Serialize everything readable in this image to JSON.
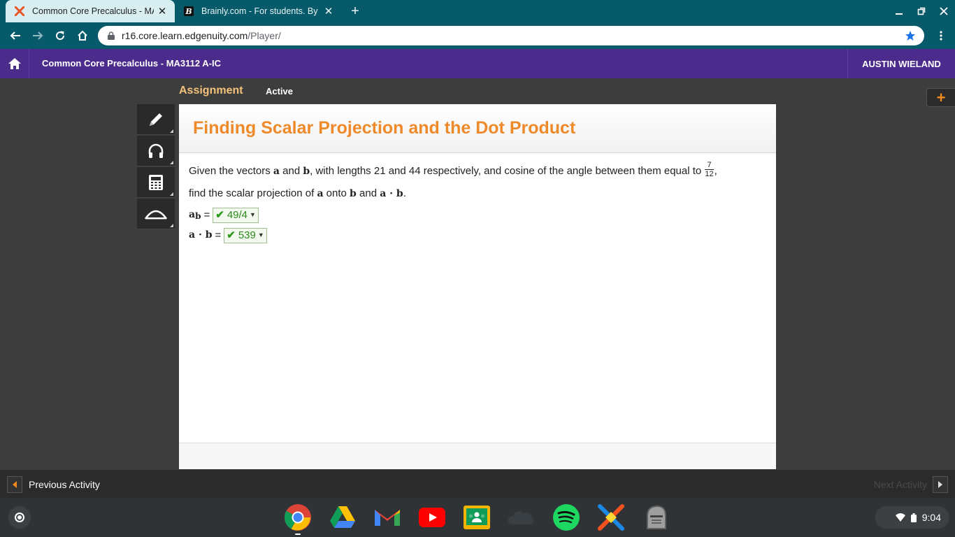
{
  "browser": {
    "tabs": [
      {
        "title": "Common Core Precalculus - MA",
        "favicon": "edgenuity-x-icon",
        "active": true
      },
      {
        "title": "Brainly.com - For students. By st",
        "favicon": "brainly-b-icon",
        "active": false
      }
    ],
    "url_host": "r16.core.learn.edgenuity.com",
    "url_path": "/Player/"
  },
  "header": {
    "course_title": "Common Core Precalculus - MA3112 A-IC",
    "user_name": "AUSTIN WIELAND"
  },
  "assignment": {
    "label": "Assignment",
    "status": "Active"
  },
  "tools": [
    {
      "name": "pencil-icon"
    },
    {
      "name": "headphones-icon"
    },
    {
      "name": "calculator-icon"
    },
    {
      "name": "formula-icon"
    }
  ],
  "question": {
    "title": "Finding Scalar Projection and the Dot Product",
    "text_1": "Given the vectors ",
    "vec_a": "a",
    "text_2": " and ",
    "vec_b": "b",
    "text_3": ", with lengths 21 and 44 respectively, and cosine of the angle between them equal to ",
    "frac_num": "7",
    "frac_den": "12",
    "text_4": ",",
    "text_5": "find the scalar projection of ",
    "text_6": " onto ",
    "text_7": " and ",
    "dot_expr": "a · b",
    "text_8": ".",
    "answers": [
      {
        "label_main": "a",
        "label_sub": "b",
        "equals": "=",
        "value": "49/4",
        "status": "correct"
      },
      {
        "label_main": "a · b",
        "label_sub": "",
        "equals": "=",
        "value": "539",
        "status": "correct"
      }
    ]
  },
  "navigation": {
    "previous": "Previous Activity",
    "next": "Next Activity"
  },
  "shelf": {
    "apps": [
      "chrome-icon",
      "google-drive-icon",
      "gmail-icon",
      "youtube-icon",
      "google-classroom-icon",
      "cloud-app-icon",
      "spotify-icon",
      "edgenuity-icon",
      "knight-helmet-icon"
    ],
    "time": "9:04"
  },
  "colors": {
    "browser_frame": "#075a6a",
    "edgenuity_header": "#4b2b8c",
    "title_orange": "#ef8a2a",
    "correct_green": "#2c8a1c"
  }
}
